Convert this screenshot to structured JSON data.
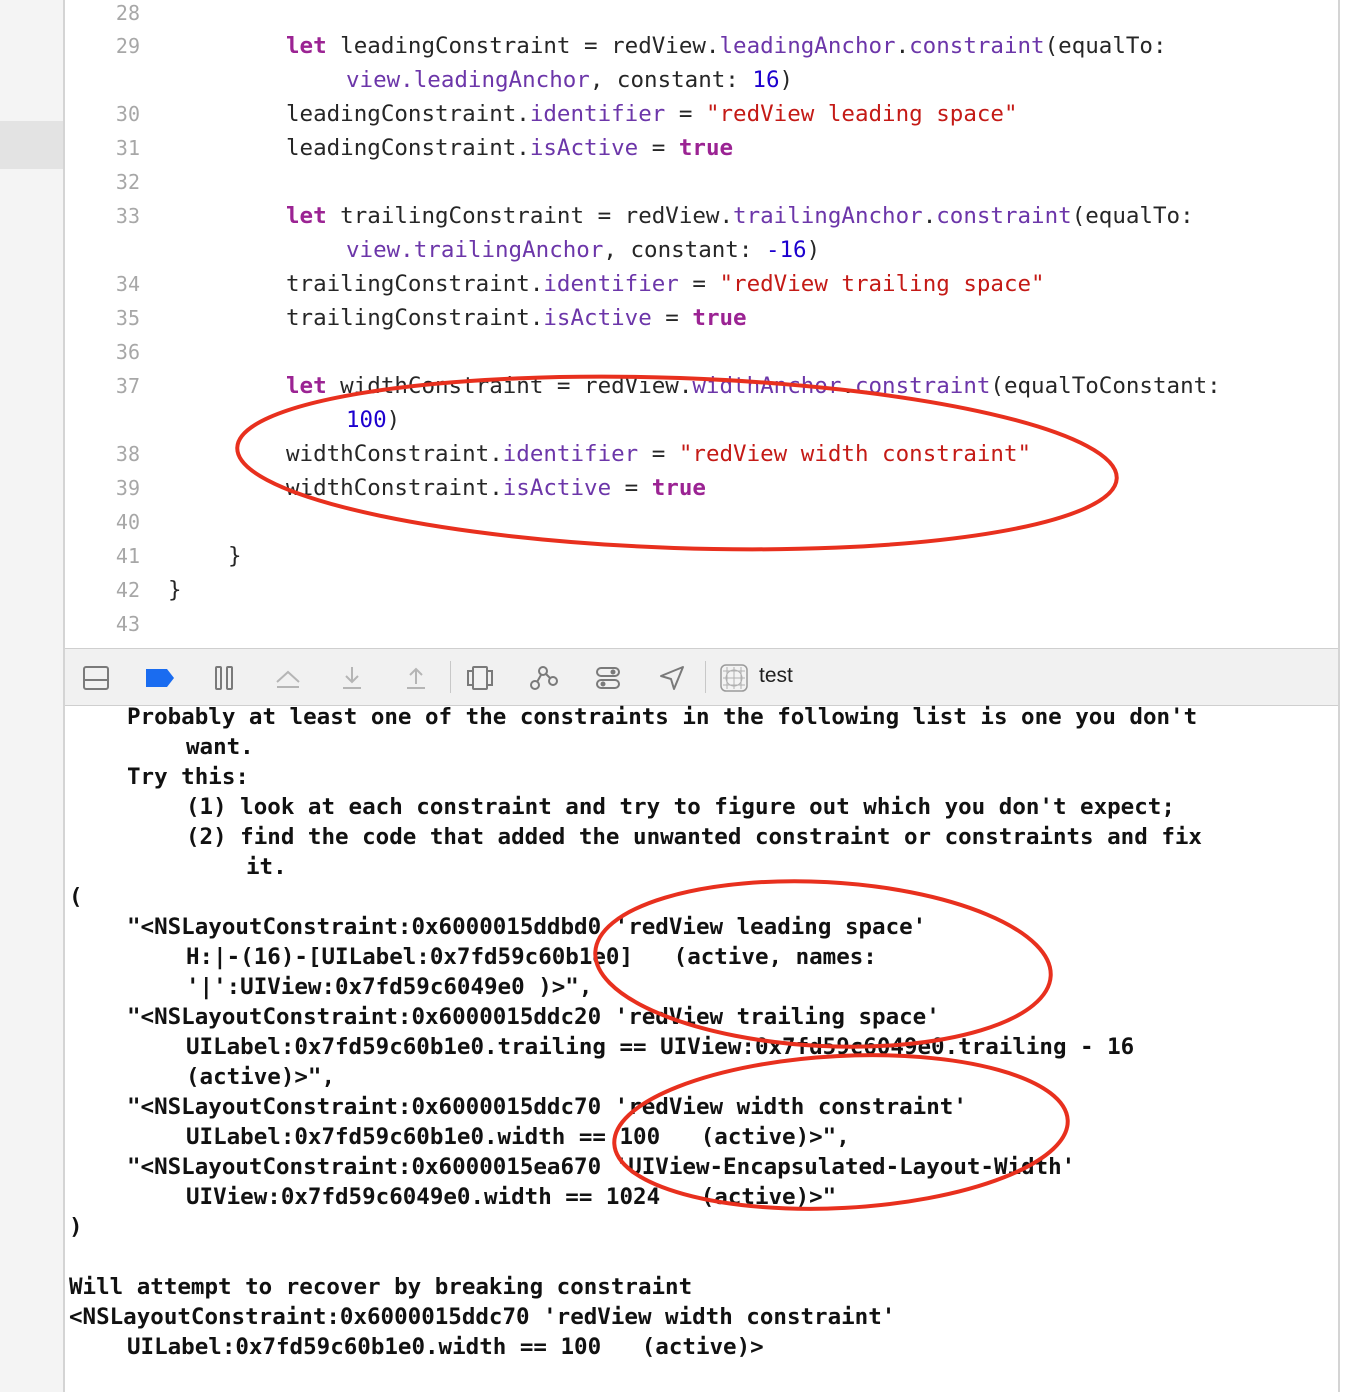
{
  "editor": {
    "lines": [
      {
        "n": "28",
        "parts": []
      },
      {
        "n": "29",
        "parts": [
          {
            "t": "let",
            "c": "kw"
          },
          {
            "t": " leadingConstraint = redView."
          },
          {
            "t": "leadingAnchor",
            "c": "prop"
          },
          {
            "t": "."
          },
          {
            "t": "constraint",
            "c": "prop"
          },
          {
            "t": "(equalTo:"
          }
        ]
      },
      {
        "n": "",
        "parts": [
          {
            "t": "view.",
            "c": "prop"
          },
          {
            "t": "leadingAnchor",
            "c": "prop"
          },
          {
            "t": ", constant: "
          },
          {
            "t": "16",
            "c": "num"
          },
          {
            "t": ")"
          }
        ]
      },
      {
        "n": "30",
        "parts": [
          {
            "t": "leadingConstraint."
          },
          {
            "t": "identifier",
            "c": "prop"
          },
          {
            "t": " = "
          },
          {
            "t": "\"redView leading space\"",
            "c": "str"
          }
        ]
      },
      {
        "n": "31",
        "parts": [
          {
            "t": "leadingConstraint."
          },
          {
            "t": "isActive",
            "c": "prop"
          },
          {
            "t": " = "
          },
          {
            "t": "true",
            "c": "kw"
          }
        ]
      },
      {
        "n": "32",
        "parts": []
      },
      {
        "n": "33",
        "parts": [
          {
            "t": "let",
            "c": "kw"
          },
          {
            "t": " trailingConstraint = redView."
          },
          {
            "t": "trailingAnchor",
            "c": "prop"
          },
          {
            "t": "."
          },
          {
            "t": "constraint",
            "c": "prop"
          },
          {
            "t": "(equalTo:"
          }
        ]
      },
      {
        "n": "",
        "parts": [
          {
            "t": "view.",
            "c": "prop"
          },
          {
            "t": "trailingAnchor",
            "c": "prop"
          },
          {
            "t": ", constant: "
          },
          {
            "t": "-16",
            "c": "num"
          },
          {
            "t": ")"
          }
        ]
      },
      {
        "n": "34",
        "parts": [
          {
            "t": "trailingConstraint."
          },
          {
            "t": "identifier",
            "c": "prop"
          },
          {
            "t": " = "
          },
          {
            "t": "\"redView trailing space\"",
            "c": "str"
          }
        ]
      },
      {
        "n": "35",
        "parts": [
          {
            "t": "trailingConstraint."
          },
          {
            "t": "isActive",
            "c": "prop"
          },
          {
            "t": " = "
          },
          {
            "t": "true",
            "c": "kw"
          }
        ]
      },
      {
        "n": "36",
        "parts": []
      },
      {
        "n": "37",
        "parts": [
          {
            "t": "let",
            "c": "kw"
          },
          {
            "t": " widthConstraint = redView."
          },
          {
            "t": "widthAnchor",
            "c": "prop"
          },
          {
            "t": "."
          },
          {
            "t": "constraint",
            "c": "prop"
          },
          {
            "t": "(equalToConstant:"
          }
        ]
      },
      {
        "n": "",
        "parts": [
          {
            "t": "100",
            "c": "num"
          },
          {
            "t": ")"
          }
        ]
      },
      {
        "n": "38",
        "parts": [
          {
            "t": "widthConstraint."
          },
          {
            "t": "identifier",
            "c": "prop"
          },
          {
            "t": " = "
          },
          {
            "t": "\"redView width constraint\"",
            "c": "str"
          }
        ]
      },
      {
        "n": "39",
        "parts": [
          {
            "t": "widthConstraint."
          },
          {
            "t": "isActive",
            "c": "prop"
          },
          {
            "t": " = "
          },
          {
            "t": "true",
            "c": "kw"
          }
        ]
      },
      {
        "n": "40",
        "parts": []
      },
      {
        "n": "41",
        "parts": [
          {
            "t": "}"
          }
        ]
      },
      {
        "n": "42",
        "parts": [
          {
            "t": "}"
          }
        ]
      },
      {
        "n": "43",
        "parts": []
      }
    ]
  },
  "toolbar": {
    "icons": [
      "hide-console-icon",
      "breakpoint-icon",
      "pause-icon",
      "step-over-icon",
      "step-into-icon",
      "step-out-icon",
      "view-hierarchy-icon",
      "memory-graph-icon",
      "environment-overrides-icon",
      "simulate-location-icon"
    ],
    "target_label": "test"
  },
  "console": {
    "lines": [
      "Probably at least one of the constraints in the following list is one you don't",
      "want.",
      "Try this:",
      "(1) look at each constraint and try to figure out which you don't expect;",
      "(2) find the code that added the unwanted constraint or constraints and fix",
      "it.",
      "(",
      "\"<NSLayoutConstraint:0x6000015ddbd0 'redView leading space'",
      "H:|-(16)-[UILabel:0x7fd59c60b1e0]   (active, names:",
      "'|':UIView:0x7fd59c6049e0 )>\",",
      "\"<NSLayoutConstraint:0x6000015ddc20 'redView trailing space'",
      "UILabel:0x7fd59c60b1e0.trailing == UIView:0x7fd59c6049e0.trailing - 16",
      "(active)>\",",
      "\"<NSLayoutConstraint:0x6000015ddc70 'redView width constraint'",
      "UILabel:0x7fd59c60b1e0.width == 100   (active)>\",",
      "\"<NSLayoutConstraint:0x6000015ea670 'UIView-Encapsulated-Layout-Width'",
      "UIView:0x7fd59c6049e0.width == 1024   (active)>\"",
      ")",
      "",
      "Will attempt to recover by breaking constraint",
      "<NSLayoutConstraint:0x6000015ddc70 'redView width constraint'",
      "UILabel:0x7fd59c60b1e0.width == 100   (active)>"
    ]
  },
  "colors": {
    "keyword": "#9b2393",
    "property": "#6c36a9",
    "string": "#c41a16",
    "number": "#1c00cf",
    "annotation": "#e8301e",
    "breakpoint_active": "#1a6cf0"
  }
}
